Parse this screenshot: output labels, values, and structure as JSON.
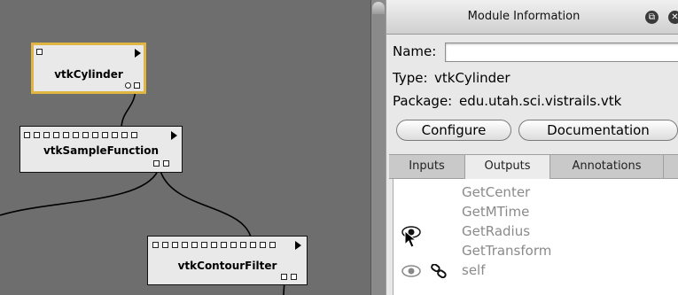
{
  "canvas": {
    "modules": [
      {
        "id": "cyl",
        "name": "vtkCylinder",
        "selected": true
      },
      {
        "id": "sample",
        "name": "vtkSampleFunction",
        "selected": false
      },
      {
        "id": "contour",
        "name": "vtkContourFilter",
        "selected": false
      }
    ]
  },
  "panel": {
    "title": "Module Information",
    "name_label": "Name:",
    "name_value": "",
    "type_label": "Type:",
    "type_value": "vtkCylinder",
    "package_label": "Package:",
    "package_value": "edu.utah.sci.vistrails.vtk",
    "configure_label": "Configure",
    "documentation_label": "Documentation",
    "tabs": [
      "Inputs",
      "Outputs",
      "Annotations"
    ],
    "active_tab": "Outputs",
    "ports": [
      {
        "label": "GetCenter",
        "icons": []
      },
      {
        "label": "GetMTime",
        "icons": []
      },
      {
        "label": "GetRadius",
        "icons": [
          "eye-icon",
          "mouse-cursor-icon"
        ]
      },
      {
        "label": "GetTransform",
        "icons": []
      },
      {
        "label": "self",
        "icons": [
          "eye-icon",
          "link-icon"
        ]
      }
    ]
  },
  "colors": {
    "canvas_bg": "#6e6e6e",
    "module_bg": "#e9e9e9",
    "selected_border": "#e0b541",
    "port_label": "#8a8a8a"
  }
}
